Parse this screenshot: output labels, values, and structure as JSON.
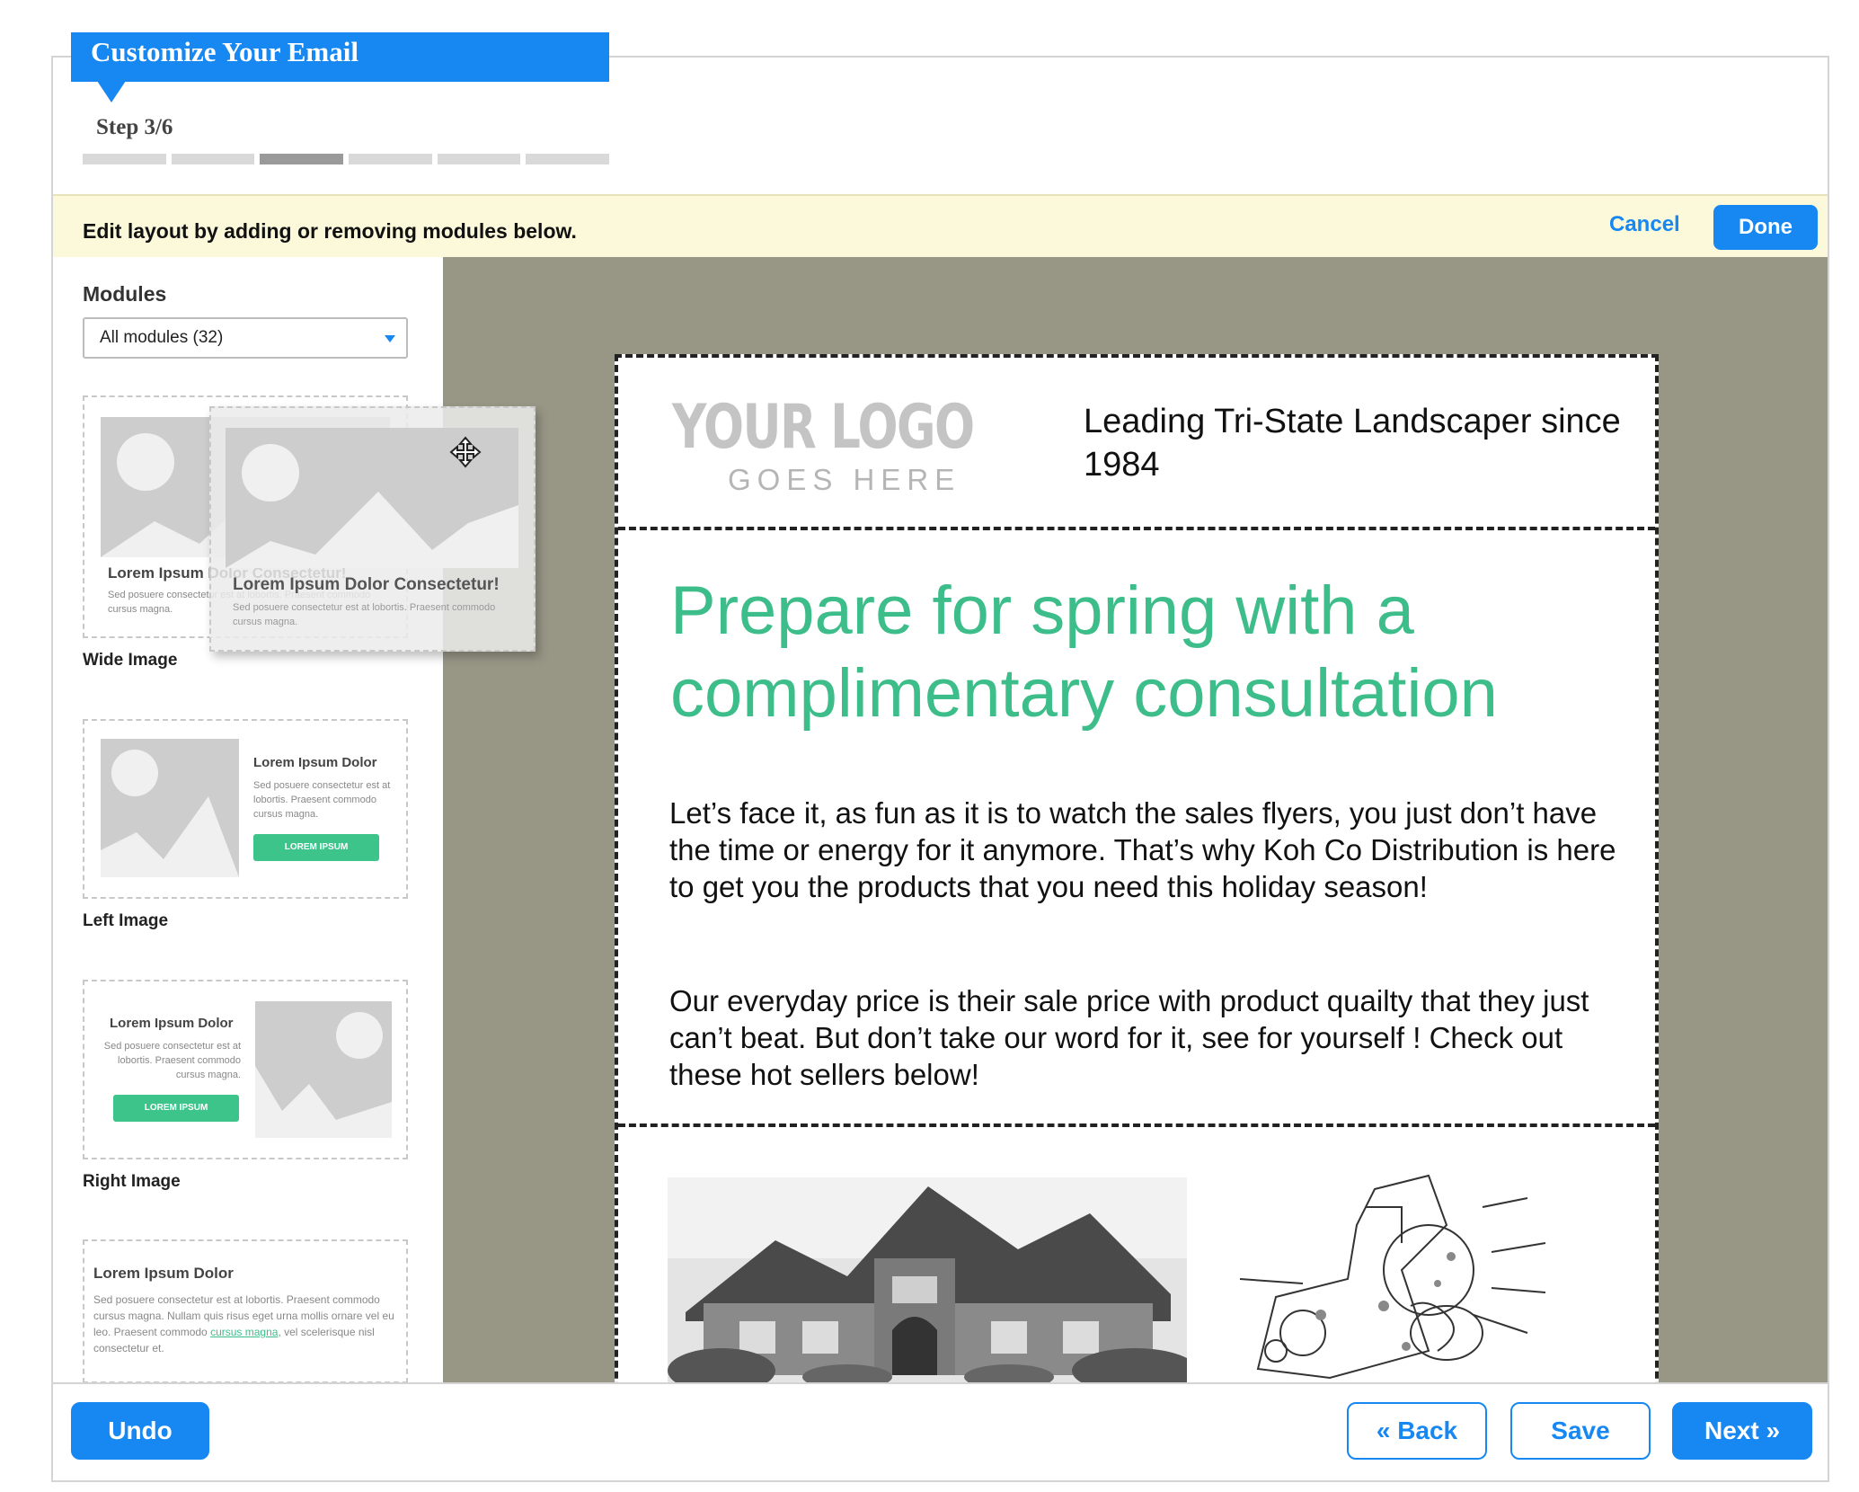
{
  "header": {
    "title": "Customize Your Email",
    "step": "Step 3/6",
    "progress": {
      "current_step": 3,
      "total_steps": 6
    }
  },
  "edit_bar": {
    "message": "Edit layout by adding or removing modules below.",
    "cancel_label": "Cancel",
    "done_label": "Done"
  },
  "sidebar": {
    "title": "Modules",
    "filter_selected": "All modules (32)",
    "modules": [
      {
        "caption": "Wide Image",
        "heading": "Lorem Ipsum Dolor Consectetur!",
        "text": "Sed posuere consectetur est at lobortis. Praesent commodo cursus magna."
      },
      {
        "caption": "Left Image",
        "heading": "Lorem Ipsum Dolor",
        "text": "Sed posuere consectetur est at lobortis. Praesent commodo cursus magna.",
        "button": "LOREM IPSUM"
      },
      {
        "caption": "Right Image",
        "heading": "Lorem Ipsum Dolor",
        "text": "Sed posuere consectetur est at lobortis. Praesent commodo cursus magna.",
        "button": "LOREM IPSUM"
      },
      {
        "caption": "",
        "heading": "Lorem Ipsum Dolor",
        "text_before": "Sed posuere consectetur est at lobortis. Praesent commodo cursus magna.  Nullam quis risus eget urna mollis ornare vel eu leo.  Praesent commodo",
        "link": "cursus magna",
        "text_after": ", vel scelerisque nisl consectetur et."
      }
    ],
    "dragging": {
      "heading": "Lorem Ipsum Dolor Consectetur!",
      "text": "Sed posuere consectetur est at lobortis. Praesent commodo cursus magna."
    }
  },
  "email": {
    "logo_main": "YOUR LOGO",
    "logo_sub": "GOES HERE",
    "tagline": "Leading Tri-State Landscaper since 1984",
    "headline": "Prepare for spring with a complimentary consultation",
    "paragraph1": "Let’s face it, as fun as it is to watch the sales flyers, you just don’t have the time or energy for it anymore. That’s why Koh Co Distribution is here to get you the products that you need this holiday season!",
    "paragraph2": "Our everyday price is their sale price with product quailty that they just can’t beat. But don’t take our word for it, see for yourself ! Check out these hot sellers below!"
  },
  "footer": {
    "undo_label": "Undo",
    "back_label": "« Back",
    "save_label": "Save",
    "next_label": "Next »"
  },
  "colors": {
    "accent": "#1787f2",
    "headline_green": "#3dbd8a",
    "canvas_bg": "#989786",
    "notice_bg": "#fbf9d9"
  }
}
